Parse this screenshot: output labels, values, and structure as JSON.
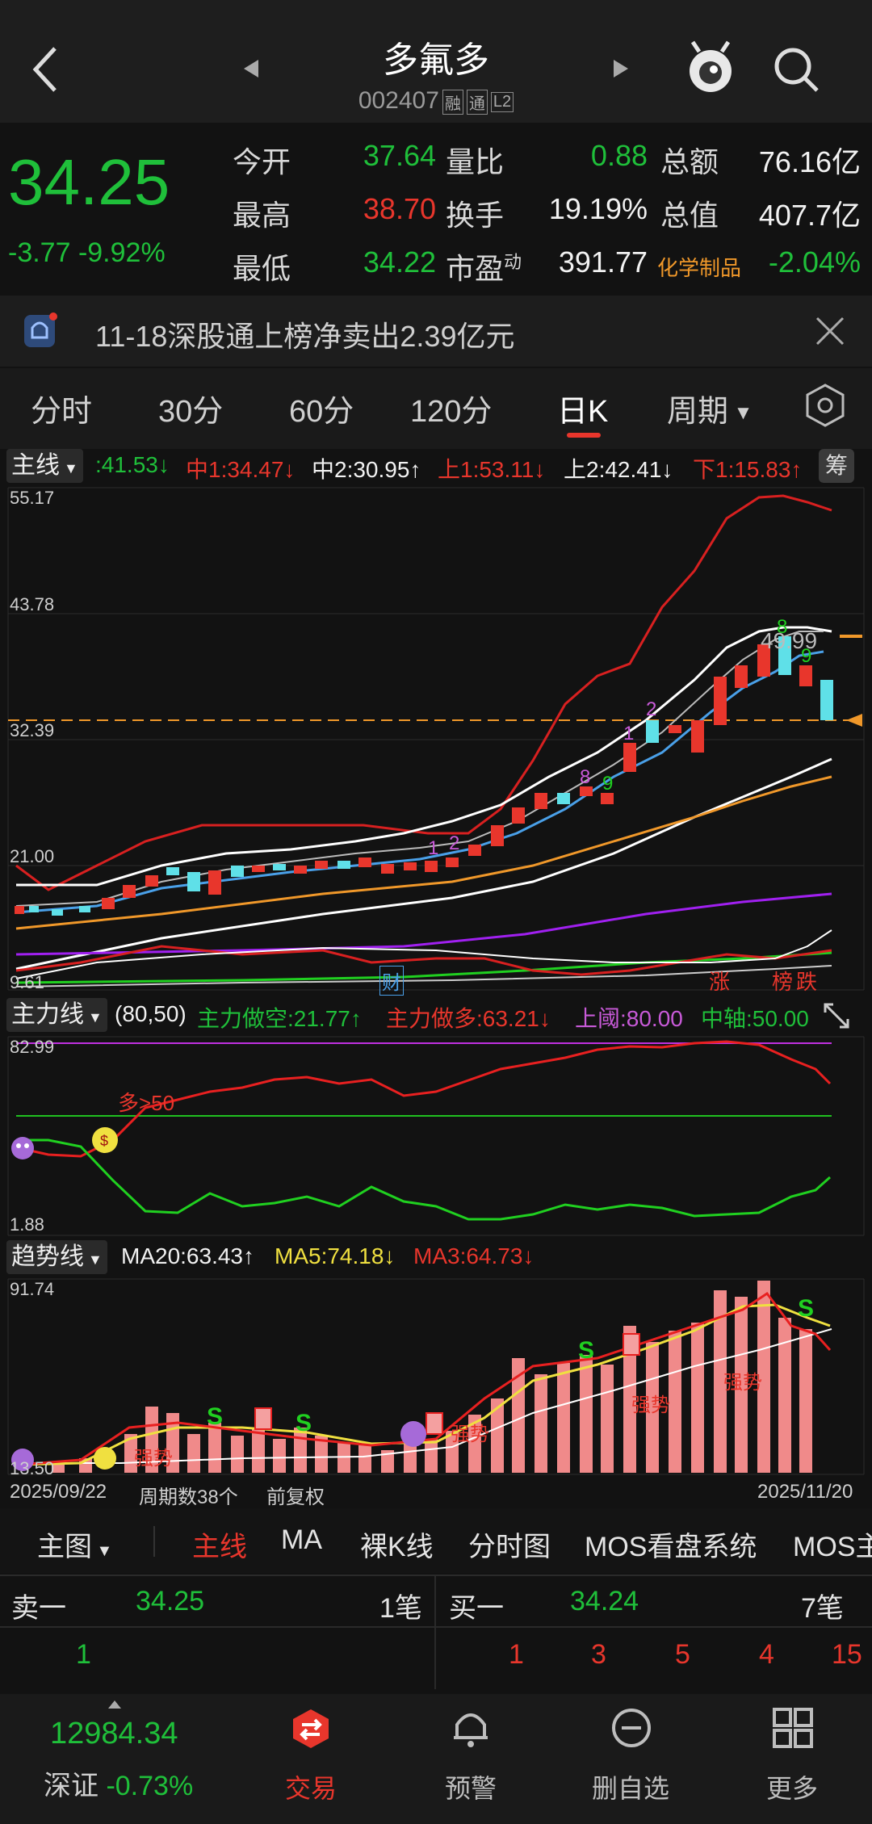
{
  "header": {
    "title": "多氟多",
    "code": "002407",
    "tags": [
      "融",
      "通",
      "L2"
    ]
  },
  "quote": {
    "price": "34.25",
    "change": "-3.77",
    "change_pct": "-9.92%",
    "rows": [
      {
        "l1": "今开",
        "v1": "37.64",
        "l2": "量比",
        "v2": "0.88",
        "l3": "总额",
        "v3": "76.16亿"
      },
      {
        "l1": "最高",
        "v1": "38.70",
        "l2": "换手",
        "v2": "19.19%",
        "l3": "总值",
        "v3": "407.7亿"
      },
      {
        "l1": "最低",
        "v1": "34.22",
        "l2": "市盈",
        "l2sup": "动",
        "v2": "391.77",
        "l3": "化学制品",
        "v3": "-2.04%"
      }
    ]
  },
  "notice": {
    "text": "11-18深股通上榜净卖出2.39亿元"
  },
  "tabs": [
    "分时",
    "30分",
    "60分",
    "120分",
    "日K",
    "周期"
  ],
  "main_indicator": {
    "label": "主线",
    "items": [
      ":41.53↓",
      "中1:34.47↓",
      "中2:30.95↑",
      "上1:53.11↓",
      "上2:42.41↓",
      "下1:15.83↑"
    ],
    "side_button": "筹",
    "axis": [
      "55.17",
      "43.78",
      "32.39",
      "21.00",
      "9.61"
    ],
    "price_labels": [
      "49.99"
    ],
    "events": [
      "财",
      "涨",
      "榜",
      "跌"
    ]
  },
  "force_indicator": {
    "label": "主力线",
    "params": "(80,50)",
    "items": [
      "主力做空:21.77↑",
      "主力做多:63.21↓",
      "上阈:80.00",
      "中轴:50.00"
    ],
    "axis": [
      "82.99",
      "1.88"
    ],
    "annotation": "多>50"
  },
  "trend_indicator": {
    "label": "趋势线",
    "items": [
      "MA20:63.43↑",
      "MA5:74.18↓",
      "MA3:64.73↓"
    ],
    "axis": [
      "91.74",
      "13.50"
    ],
    "date_start": "2025/09/22",
    "period_count": "周期数38个",
    "adjust": "前复权",
    "date_end": "2025/11/20",
    "labels": [
      "强势",
      "强势",
      "强势",
      "强势"
    ]
  },
  "main_tabs": [
    "主图",
    "主线",
    "MA",
    "裸K线",
    "分时图",
    "MOS看盘系统",
    "MOS主"
  ],
  "orderbook": {
    "sell_label": "卖一",
    "sell_price": "34.25",
    "sell_count": "1笔",
    "buy_label": "买一",
    "buy_price": "34.24",
    "buy_count": "7笔",
    "sell_detail": [
      "1"
    ],
    "buy_detail": [
      "1",
      "3",
      "5",
      "4",
      "15"
    ]
  },
  "bottom_bar": {
    "index_value": "12984.34",
    "index_name": "深证",
    "index_change": "-0.73%",
    "nav": [
      "交易",
      "预警",
      "删自选",
      "更多"
    ]
  },
  "colors": {
    "up": "#e8362c",
    "down": "#1fbf3a",
    "accent_orange": "#f0982a",
    "cyan": "#5fe0e8"
  }
}
